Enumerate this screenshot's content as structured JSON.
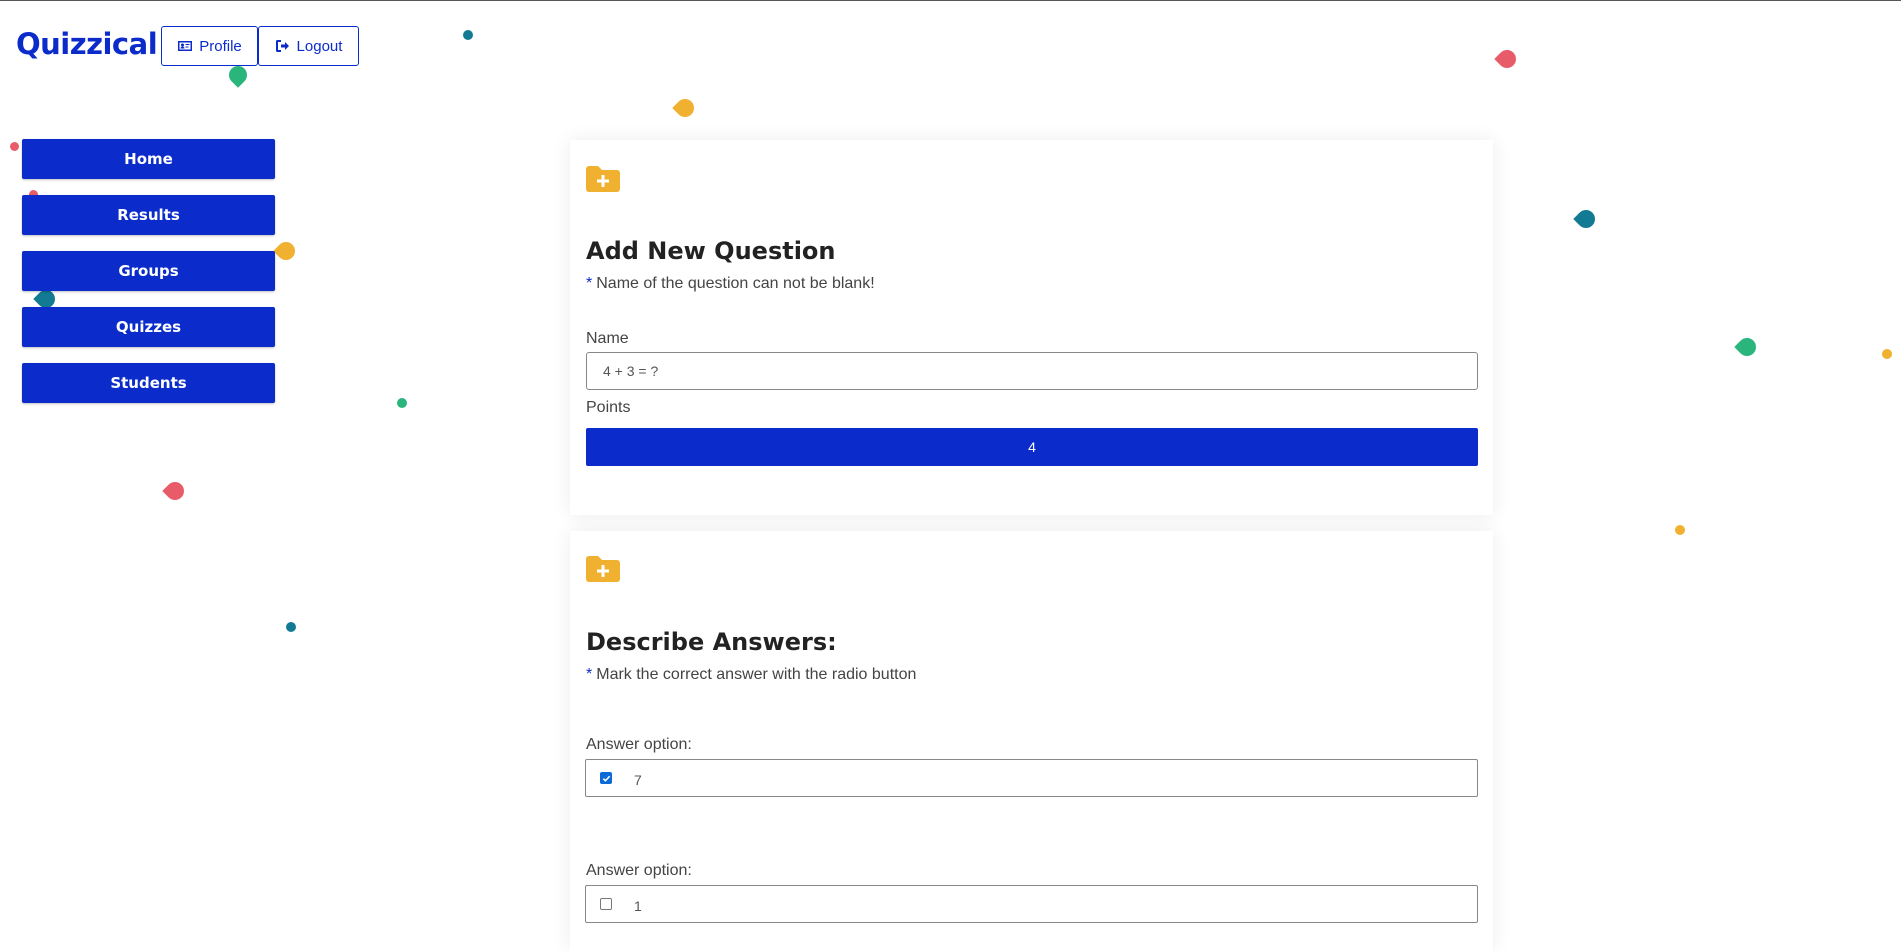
{
  "app": {
    "title": "Quizzical"
  },
  "header": {
    "profile_label": "Profile",
    "logout_label": "Logout"
  },
  "sidebar": {
    "items": [
      {
        "label": "Home"
      },
      {
        "label": "Results"
      },
      {
        "label": "Groups"
      },
      {
        "label": "Quizzes"
      },
      {
        "label": "Students"
      }
    ]
  },
  "question_card": {
    "icon": "folder-plus-icon",
    "title": "Add New Question",
    "hint": "Name of the question can not be blank!",
    "name_label": "Name",
    "name_value": "4 + 3 = ?",
    "points_label": "Points",
    "points_value": "4"
  },
  "answers_card": {
    "icon": "folder-plus-icon",
    "title": "Describe Answers:",
    "hint": "Mark the correct answer with the radio button",
    "answers": [
      {
        "label": "Answer option:",
        "value": "7",
        "correct": true
      },
      {
        "label": "Answer option:",
        "value": "1",
        "correct": false
      }
    ]
  },
  "colors": {
    "primary": "#0b2ccb",
    "folder": "#f0b030",
    "confetti": [
      "#e85c6a",
      "#2ab57d",
      "#f0b030",
      "#137a94"
    ]
  }
}
